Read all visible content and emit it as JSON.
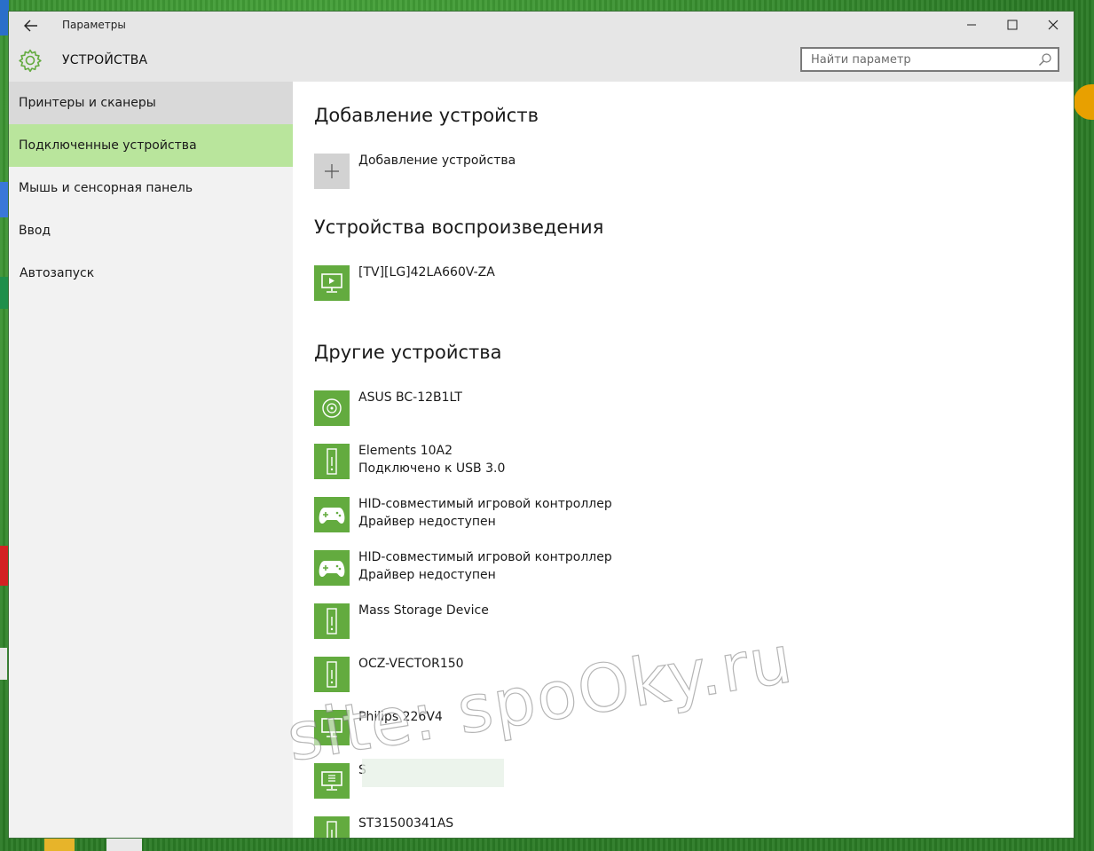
{
  "window": {
    "title": "Параметры",
    "section_title": "УСТРОЙСТВА",
    "search_placeholder": "Найти параметр"
  },
  "sidebar": {
    "items": [
      {
        "label": "Принтеры и сканеры",
        "state": "hover"
      },
      {
        "label": "Подключенные устройства",
        "state": "active"
      },
      {
        "label": "Мышь и сенсорная панель",
        "state": "normal"
      },
      {
        "label": "Ввод",
        "state": "normal"
      },
      {
        "label": "Автозапуск",
        "state": "normal"
      }
    ]
  },
  "main": {
    "add_section": {
      "heading": "Добавление устройств",
      "button_label": "Добавление устройства"
    },
    "playback_section": {
      "heading": "Устройства воспроизведения",
      "devices": [
        {
          "name": "[TV][LG]42LA660V-ZA",
          "icon": "tv-play-icon"
        }
      ]
    },
    "other_section": {
      "heading": "Другие устройства",
      "devices": [
        {
          "name": "ASUS BC-12B1LT",
          "status": "",
          "icon": "disc-icon"
        },
        {
          "name": "Elements 10A2",
          "status": "Подключено к USB 3.0",
          "icon": "drive-icon"
        },
        {
          "name": "HID-совместимый игровой контроллер",
          "status": "Драйвер недоступен",
          "icon": "gamepad-icon"
        },
        {
          "name": "HID-совместимый игровой контроллер",
          "status": "Драйвер недоступен",
          "icon": "gamepad-icon"
        },
        {
          "name": "Mass Storage Device",
          "status": "",
          "icon": "drive-icon"
        },
        {
          "name": "OCZ-VECTOR150",
          "status": "",
          "icon": "drive-icon"
        },
        {
          "name": "Philips 226V4",
          "status": "",
          "icon": "monitor-icon"
        },
        {
          "name": "S",
          "status": "",
          "icon": "monitor-list-icon"
        },
        {
          "name": "ST31500341AS",
          "status": "",
          "icon": "drive-icon"
        }
      ]
    }
  },
  "watermark": {
    "text": "site: spoOky.ru"
  },
  "colors": {
    "accent": "#63ab3f",
    "active_nav": "#b9e59c",
    "header_bg": "#e6e6e6"
  }
}
